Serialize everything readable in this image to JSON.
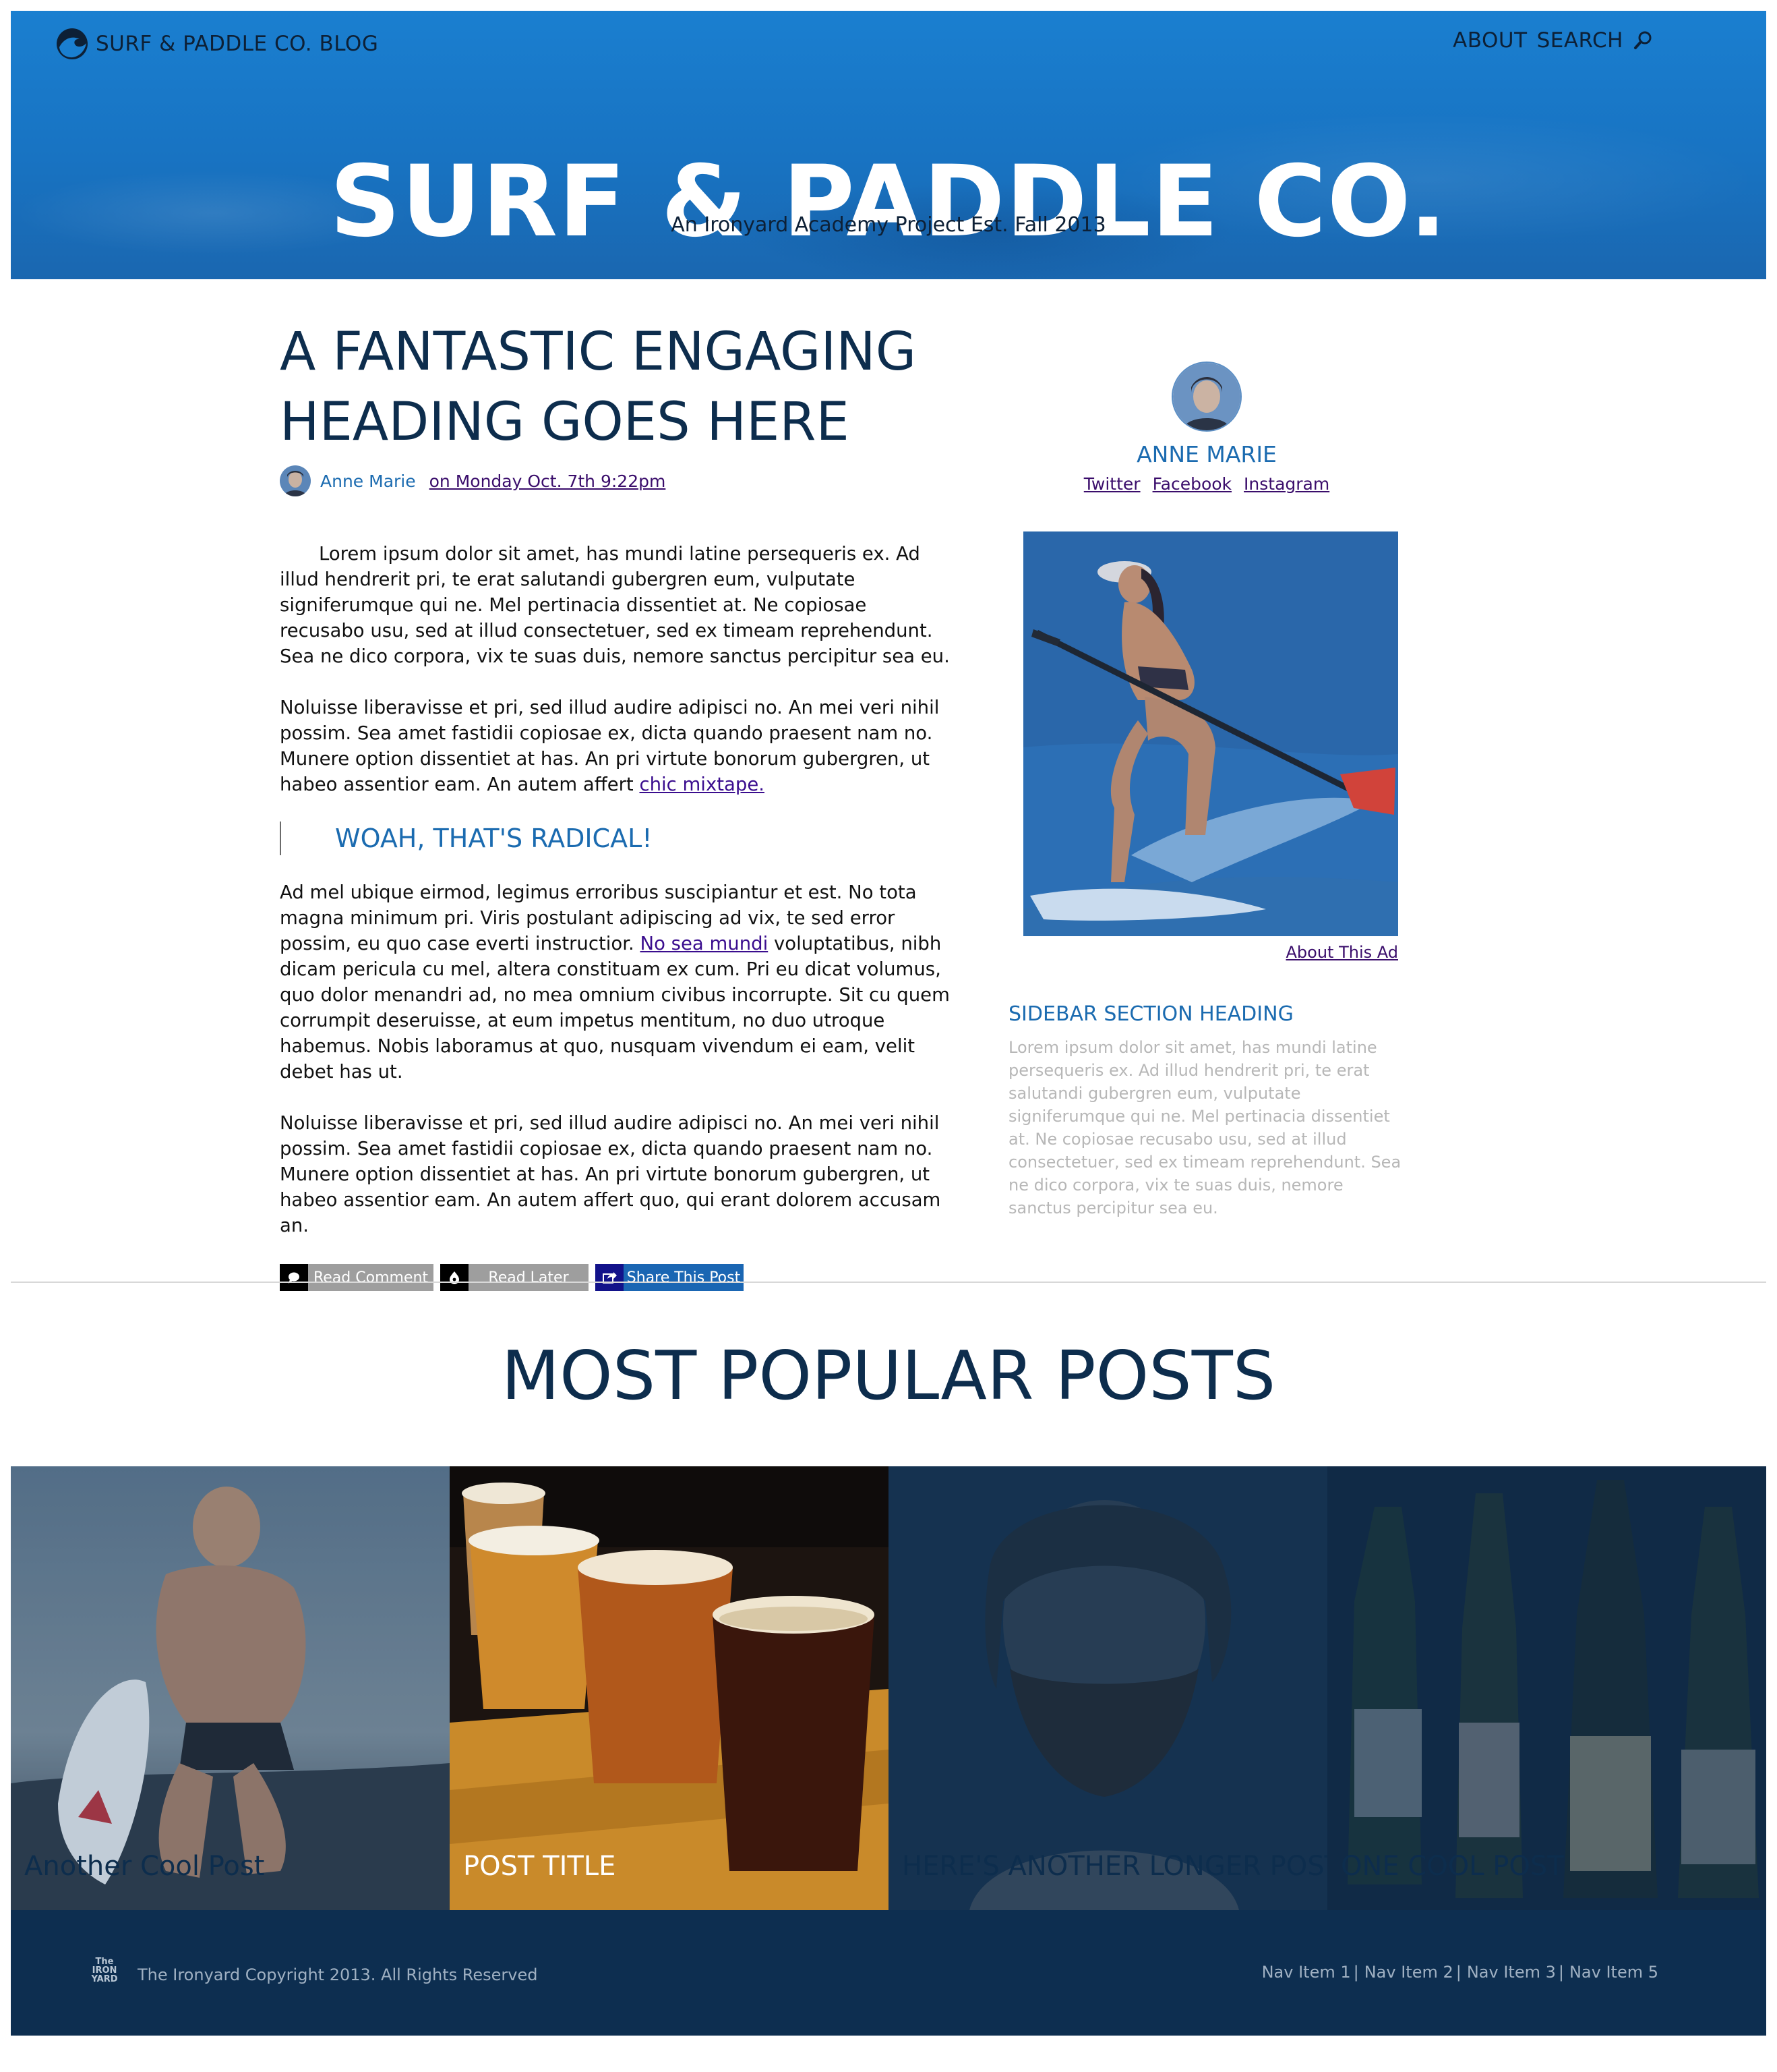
{
  "header": {
    "logo_text": "SURF & PADDLE CO. BLOG",
    "nav_about": "ABOUT",
    "nav_search": "SEARCH",
    "title": "SURF & PADDLE CO.",
    "subtitle": "An Ironyard Academy Project Est. Fall 2013"
  },
  "article": {
    "title_line1": "A FANTASTIC ENGAGING",
    "title_line2": "HEADING GOES HERE",
    "author": "Anne Marie",
    "date": "on Monday Oct. 7th 9:22pm",
    "p1": "Lorem ipsum dolor sit amet, has mundi latine persequeris ex. Ad illud hendrerit pri, te erat salutandi gubergren eum, vulputate signiferumque qui ne. Mel pertinacia dissentiet at. Ne copiosae recusabo usu, sed at illud consectetuer, sed ex timeam reprehendunt. Sea ne dico corpora, vix te suas duis, nemore sanctus percipitur sea eu.",
    "p2": "Noluisse liberavisse et pri, sed illud audire adipisci no. An mei veri nihil possim. Sea amet fastidii copiosae ex, dicta quando praesent nam no. Munere option dissentiet at has. An pri virtute bonorum gubergren, ut habeo assentior eam. An autem affert",
    "p2_link": "chic mixtape.",
    "pullquote": "WOAH, THAT'S RADICAL!",
    "p3_before": "Ad mel ubique eirmod, legimus erroribus suscipiantur et est. No tota magna minimum pri. Viris postulant adipiscing ad vix, te sed error possim, eu quo case everti instructior.",
    "p3_link": "No sea mundi",
    "p3_after": "voluptatibus, nibh dicam pericula cu mel, altera constituam ex cum. Pri eu dicat volumus, quo dolor menandri ad, no mea omnium civibus incorrupte. Sit cu quem corrumpit deseruisse, at eum impetus mentitum, no duo utroque habemus. Nobis laboramus at quo, nusquam vivendum ei eam, velit debet has ut.",
    "p4": "Noluisse liberavisse et pri, sed illud audire adipisci no. An mei veri nihil possim. Sea amet fastidii copiosae ex, dicta quando praesent nam no. Munere option dissentiet at has. An pri virtute bonorum gubergren, ut habeo assentior eam. An autem affert quo, qui erant dolorem accusam an.",
    "actions": {
      "read_comment": "Read Comment",
      "read_later": "Read Later",
      "share": "Share This Post"
    }
  },
  "sidebar": {
    "profile_name": "ANNE MARIE",
    "links": [
      "Twitter",
      "Facebook",
      "Instagram"
    ],
    "ad_link": "About This Ad",
    "section_heading": "SIDEBAR SECTION HEADING",
    "section_text": "Lorem ipsum dolor sit amet, has mundi latine persequeris ex. Ad illud hendrerit pri, te erat salutandi gubergren eum, vulputate signiferumque qui ne. Mel pertinacia dissentiet at. Ne copiosae recusabo usu, sed at illud consectetuer, sed ex timeam reprehendunt. Sea ne dico corpora, vix te suas duis, nemore sanctus percipitur sea eu."
  },
  "popular": {
    "title": "MOST POPULAR POSTS",
    "tiles": [
      {
        "caption": "Another Cool Post"
      },
      {
        "caption": "POST TITLE"
      },
      {
        "caption": "HERE'S ANOTHER LONGER POST"
      },
      {
        "caption": "ONE COOL POST"
      }
    ]
  },
  "footer": {
    "logo_text": "The IRON YARD",
    "copyright": "The Ironyard Copyright 2013. All Rights Reserved",
    "nav": [
      "Nav Item 1",
      "Nav Item 2",
      "Nav Item 3",
      "Nav Item 5"
    ]
  },
  "colors": {
    "brand_blue": "#1a75c7",
    "navy": "#0d2e50",
    "link_purple": "#3a0d6b",
    "accent_blue": "#1b6bb0"
  }
}
